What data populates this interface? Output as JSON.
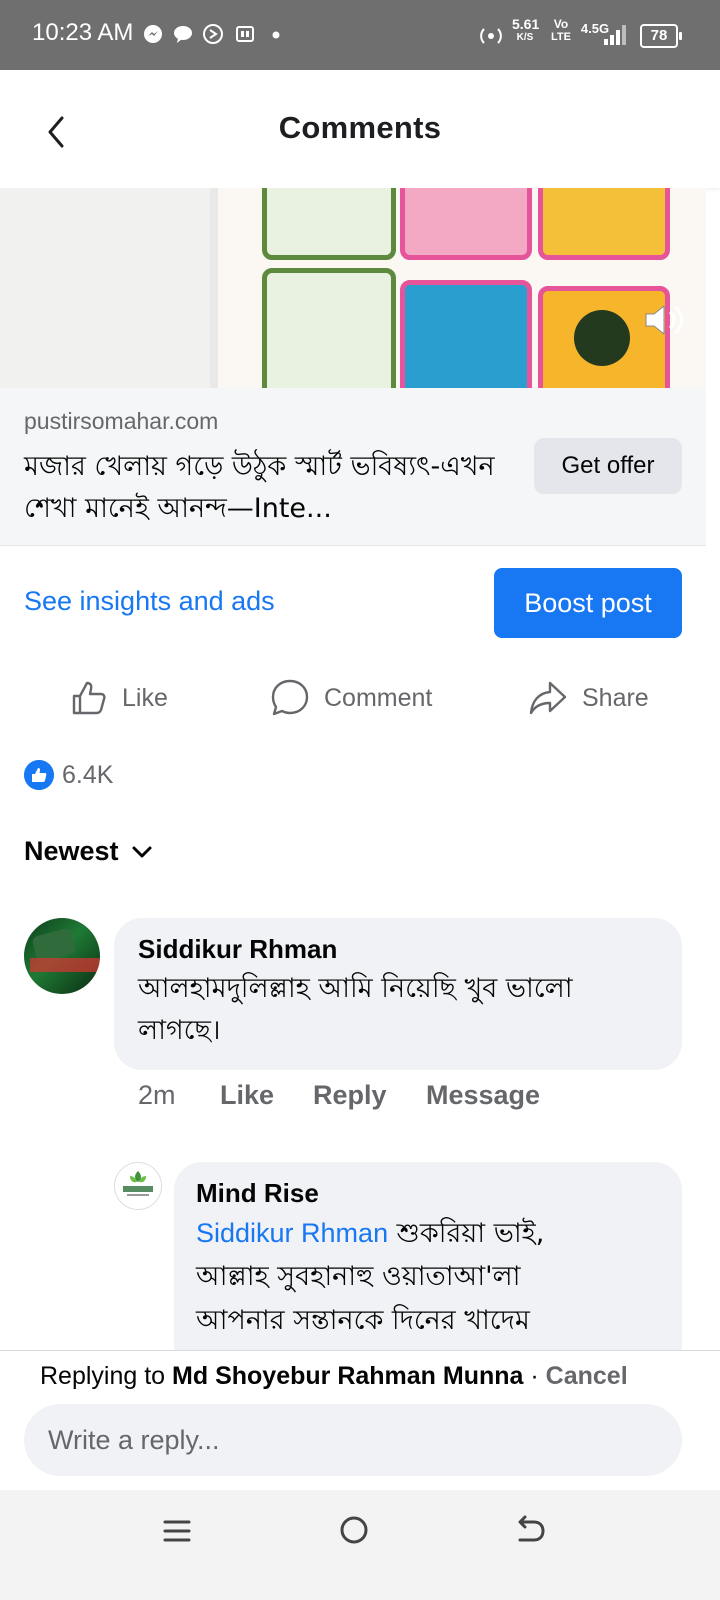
{
  "status_bar": {
    "time": "10:23 AM",
    "speed": "5.61",
    "speed_unit": "K/S",
    "vo": "Vo",
    "lte": "LTE",
    "network": "4.5G",
    "battery": "78"
  },
  "header": {
    "title": "Comments"
  },
  "ad": {
    "domain": "pustirsomahar.com",
    "headline": "মজার খেলায় গড়ে উঠুক স্মার্ট ভবিষ্যৎ-এখন শেখা মানেই আনন্দ—Inte...",
    "cta": "Get offer"
  },
  "insights": {
    "link": "See insights and ads",
    "boost": "Boost post"
  },
  "actions": {
    "like": "Like",
    "comment": "Comment",
    "share": "Share"
  },
  "reactions": {
    "count": "6.4K"
  },
  "sort": {
    "label": "Newest"
  },
  "comments": [
    {
      "author": "Siddikur Rhman",
      "text": "আলহামদুলিল্লাহ আমি  নিয়েছি খুব ভালো লাগছে।",
      "time": "2m",
      "like": "Like",
      "reply": "Reply",
      "message": "Message"
    },
    {
      "author": "Mind Rise",
      "mention": "Siddikur Rhman",
      "text_line1": " শুকরিয়া ভাই,",
      "text_line2": "আল্লাহ সুবহানাহু ওয়াতাআ'লা",
      "text_line3": "আপনার সন্তানকে দিনের খাদেম"
    }
  ],
  "reply_bar": {
    "prefix": "Replying to ",
    "name": "Md Shoyebur Rahman Munna",
    "separator": " · ",
    "cancel": "Cancel",
    "placeholder": "Write a reply..."
  },
  "colors": {
    "accent": "#1877f2",
    "status_bar": "#6f6f6f",
    "bubble": "#f0f2f5",
    "secondary_text": "#65676b"
  }
}
